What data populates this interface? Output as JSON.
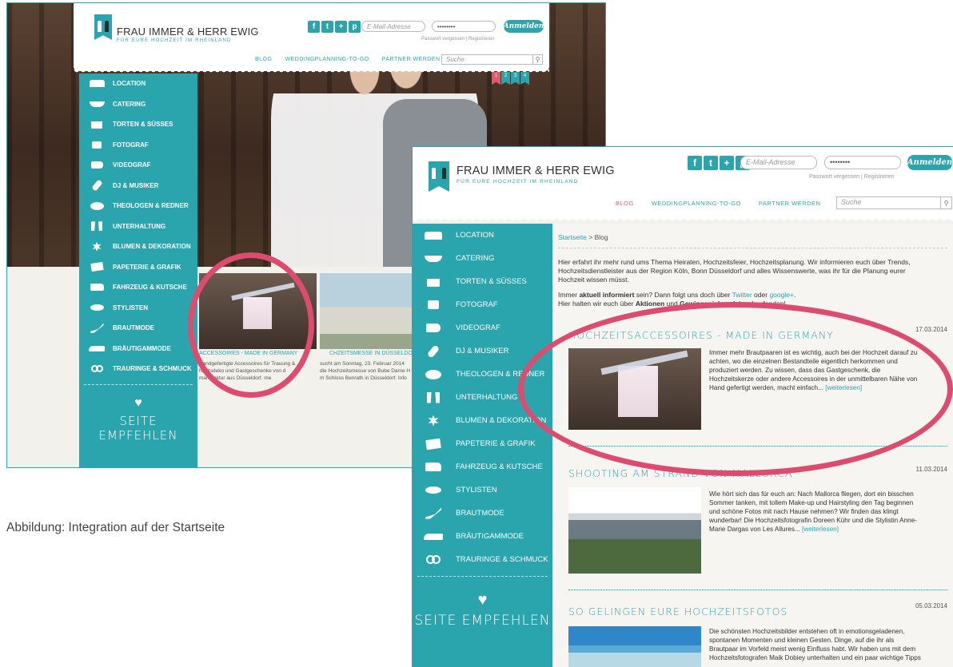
{
  "brand": {
    "title": "FRAU IMMER & HERR EWIG",
    "subtitle": "FÜR EURE HOCHZEIT IM RHEINLAND"
  },
  "header": {
    "social": [
      "f",
      "t",
      "+",
      "p"
    ],
    "email_placeholder": "E-Mail-Adresse",
    "password_value": "••••••••",
    "login_label": "Anmelden",
    "password_forgot": "Passwort vergessen",
    "divider": "|",
    "register": "Registrieren",
    "search_placeholder": "Suche"
  },
  "nav": {
    "blog": "BLOG",
    "weddingplanning": "WEDDINGPLANNING-TO-GO",
    "partner": "PARTNER WERDEN"
  },
  "pager": [
    "1",
    "2",
    "3",
    "4"
  ],
  "sidebar": {
    "items": [
      {
        "label": "LOCATION",
        "icon": "bus-icon"
      },
      {
        "label": "CATERING",
        "icon": "bowl-icon"
      },
      {
        "label": "TORTEN & SÜSSES",
        "icon": "cake-icon"
      },
      {
        "label": "FOTOGRAF",
        "icon": "camera-icon"
      },
      {
        "label": "VIDEOGRAF",
        "icon": "video-camera-icon"
      },
      {
        "label": "DJ & MUSIKER",
        "icon": "guitar-icon"
      },
      {
        "label": "THEOLOGEN & REDNER",
        "icon": "speech-bubble-icon"
      },
      {
        "label": "UNTERHALTUNG",
        "icon": "curtain-icon"
      },
      {
        "label": "BLUMEN & DEKORATION",
        "icon": "flower-icon"
      },
      {
        "label": "PAPETERIE & GRAFIK",
        "icon": "envelope-icon"
      },
      {
        "label": "FAHRZEUG & KUTSCHE",
        "icon": "car-icon"
      },
      {
        "label": "STYLISTEN",
        "icon": "lips-icon"
      },
      {
        "label": "BRAUTMODE",
        "icon": "high-heel-icon"
      },
      {
        "label": "BRÄUTIGAMMODE",
        "icon": "shoe-icon"
      },
      {
        "label": "TRAURINGE & SCHMUCK",
        "icon": "rings-icon"
      }
    ],
    "back_items": [
      "LOCATION",
      "CATERING",
      "TORTEN & SÜSSES",
      "FOTOGRAF",
      "VIDEOGRAF",
      "DJ & MUSIKER",
      "THEOLOGEN & REDNER",
      "UNTERHALTUNG",
      "BLUMEN & DEKORATION",
      "PAPETERIE & GRAFIK",
      "FAHRZEUG & KUTSCHE",
      "STYLISTEN",
      "BRAUTMODE",
      "BRÄUTIGAMMODE",
      "TRAURINGE & SCHMUCK"
    ],
    "recommend": "SEITE EMPFEHLEN"
  },
  "back_cards": {
    "card1_title": "ACCESSOIRES - MADE IN GERMANY",
    "card1_text": [
      "Handgefertigte Accessoires für Trauung &",
      "hzeitsdeko und Gastgeschenke von d",
      "manufaktur aus Düsseldorf. me"
    ],
    "card2_title": "CHZEITSMESSE IN DÜSSELDO",
    "card2_text": [
      "sucht am Sonntag, 23. Februar 2014",
      "die Hochzeitsmesse von Bube Dame H",
      "m Schloss Benrath in Düsseldorf. Info"
    ]
  },
  "blog": {
    "breadcrumb_home": "Startseite",
    "breadcrumb_sep": ">",
    "breadcrumb_current": "Blog",
    "intro_lines": [
      "Hier erfahrt ihr mehr rund ums Thema Heiraten, Hochzeitsfeier, Hochzeitsplanung. Wir informieren euch über Trends,",
      "Hochzeitsdienstleister aus der Region Köln, Bonn Düsseldorf und alles Wissenswerte, was ihr für die Planung eurer",
      "Hochzeit wissen müsst."
    ],
    "follow_pre": "Immer ",
    "follow_bold": "aktuell informiert",
    "follow_mid": " sein? Dann folgt uns doch über ",
    "follow_link1": "Twitter",
    "follow_or": " oder ",
    "follow_link2": "google+",
    "follow_end": ".",
    "follow2_pre": "Hier halten wir euch über ",
    "follow2_bold1": "Aktionen",
    "follow2_and": " und ",
    "follow2_bold2": "Gewinnspiele",
    "follow2_end": " auf dem Laufenden!",
    "more": "[weiterlesen]",
    "posts": [
      {
        "title": "HOCHZEITSACCESSOIRES - MADE IN GERMANY",
        "date": "17.03.2014",
        "lines": [
          "Immer mehr Brautpaaren ist es wichtig, auch bei der Hochzeit darauf zu",
          "achten, wo die einzelnen Bestandteile eigentlich herkommen und",
          "produziert werden. Zu wissen, dass das Gastgeschenk, die",
          "Hochzeitskerze oder andere Accessoires in der unmittelbaren Nähe von",
          "Hand gefertigt werden, macht einfach..."
        ]
      },
      {
        "title": "SHOOTING AM STRAND VON MALLORCA",
        "date": "11.03.2014",
        "lines": [
          "Wie hört sich das für euch an: Nach Mallorca fliegen, dort ein bisschen",
          "Sommer tanken, mit tollem Make-up und Hairstyling den Tag beginnen",
          "und schöne Fotos mit nach Hause nehmen? Wir finden das klingt",
          "wunderbar! Die Hochzeitsfotografin Doreen Kühr und die Stylistin Anne-",
          "Marie Dargas von Les Allures..."
        ]
      },
      {
        "title": "SO GELINGEN EURE HOCHZEITSFOTOS",
        "date": "05.03.2014",
        "lines": [
          "Die schönsten Hochzeitsbilder entstehen oft in emotionsgeladenen,",
          "spontanen Momenten und kleinen Gesten. Dinge, auf die ihr als",
          "Brautpaar im Vorfeld meist wenig Einfluss habt. Wir haben uns mit dem",
          "Hochzeitsfotografen Maik Dobiey unterhalten und ein paar wichtige Tipps"
        ]
      }
    ]
  },
  "caption": "Abbildung: Integration auf der Startseite",
  "colors": {
    "accent": "#2aa5ae",
    "highlight": "#dc4c6e",
    "active_nav": "#e5586a"
  }
}
